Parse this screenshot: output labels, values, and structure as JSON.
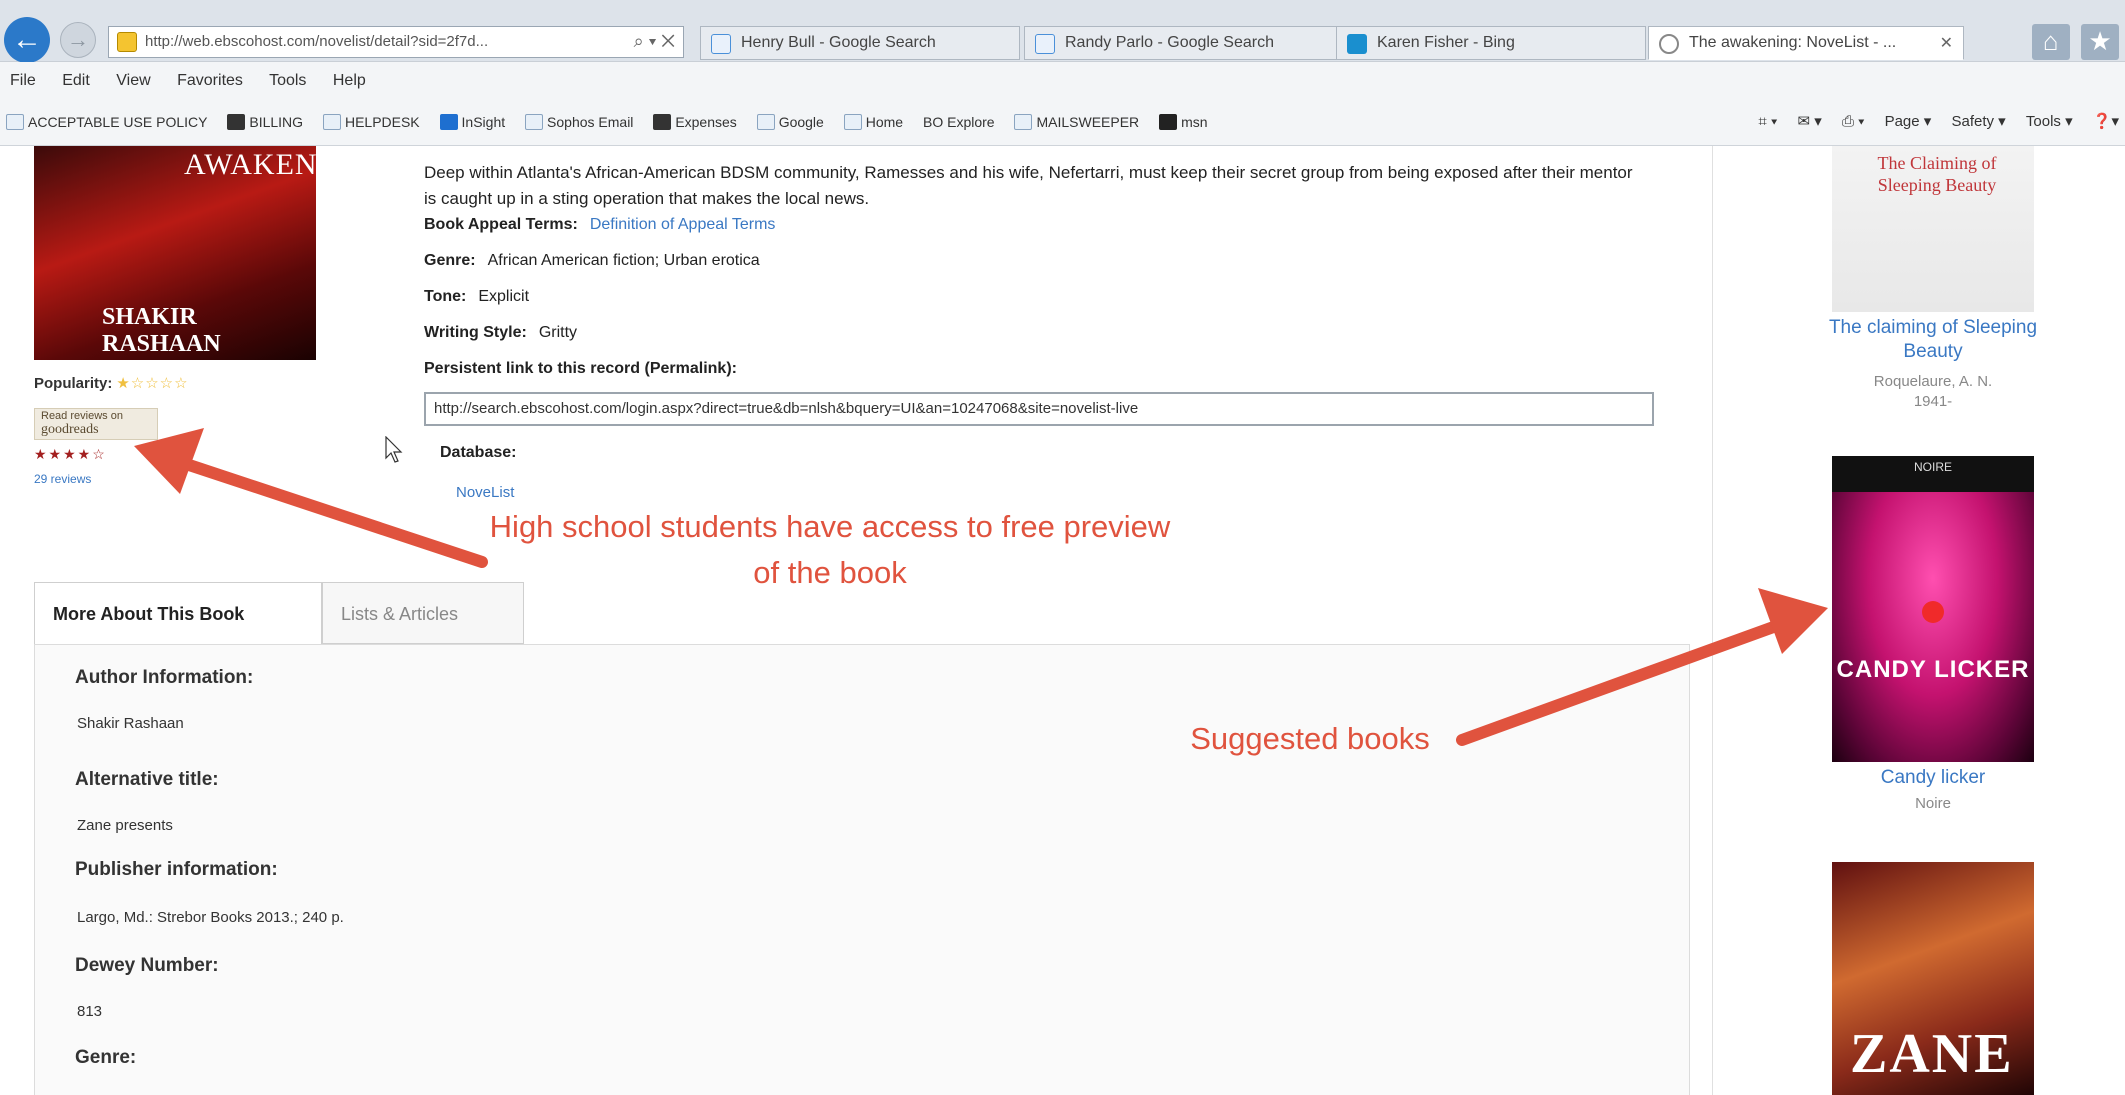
{
  "browser": {
    "address": "http://web.ebscohost.com/novelist/detail?sid=2f7d...",
    "tabs": [
      {
        "label": "Henry Bull - Google Search",
        "color": "#4a90d9"
      },
      {
        "label": "Randy Parlo - Google Search",
        "color": "#4a90d9"
      },
      {
        "label": "Karen Fisher - Bing",
        "color": "#1a8fcf"
      },
      {
        "label": "The awakening: NoveList - ...",
        "color": "#ffffff"
      }
    ],
    "window_controls": [
      "⌂",
      "★"
    ]
  },
  "menubar": [
    "File",
    "Edit",
    "View",
    "Favorites",
    "Tools",
    "Help"
  ],
  "favorites": [
    "ACCEPTABLE USE POLICY",
    "BILLING",
    "HELPDESK",
    "InSight",
    "Sophos Email",
    "Expenses",
    "Google",
    "Home",
    "BO Explore",
    "MAILSWEEPER",
    "msn"
  ],
  "commandbar": [
    "Page ▾",
    "Safety ▾",
    "Tools ▾",
    "❓▾"
  ],
  "book": {
    "cover_title": "AWAKENING",
    "cover_author": "SHAKIR RASHAAN",
    "popularity_label": "Popularity:",
    "popularity_stars": "★☆☆☆☆",
    "goodreads_small": "Read reviews on",
    "goodreads_logo": "goodreads",
    "goodreads_rating": "★★★★☆",
    "goodreads_reviews": "29 reviews",
    "summary": "Deep within Atlanta's African-American BDSM community, Ramesses and his wife, Nefertarri, must keep their secret group from being exposed after their mentor is caught up in a sting operation that makes the local news.",
    "appeal_label": "Book Appeal Terms:",
    "appeal_link": "Definition of Appeal Terms",
    "genre_label": "Genre:",
    "genre_value": "African American fiction; Urban erotica",
    "tone_label": "Tone:",
    "tone_value": "Explicit",
    "style_label": "Writing Style:",
    "style_value": "Gritty",
    "permalink_label": "Persistent link to this record (Permalink):",
    "permalink_value": "http://search.ebscohost.com/login.aspx?direct=true&db=nlsh&bquery=UI&an=10247068&site=novelist-live",
    "database_label": "Database:",
    "database_value": "NoveList"
  },
  "tabs": {
    "more": "More About This Book",
    "lists": "Lists & Articles"
  },
  "about": {
    "author_h": "Author Information:",
    "author_v": "Shakir Rashaan",
    "alt_title_h": "Alternative title:",
    "alt_title_v": "Zane presents",
    "publisher_h": "Publisher information:",
    "publisher_v": "Largo, Md.: Strebor Books 2013.; 240 p.",
    "dewey_h": "Dewey Number:",
    "dewey_v": "813",
    "genre_h": "Genre:"
  },
  "suggestions": [
    {
      "cover_text": "The Claiming of Sleeping Beauty",
      "title": "The claiming of Sleeping Beauty",
      "author": "Roquelaure, A. N.",
      "year": "1941-"
    },
    {
      "cover_top": "NOIRE",
      "cover_title": "CANDY LICKER",
      "title": "Candy licker",
      "author": "Noire"
    },
    {
      "cover_title": "ZANE"
    }
  ],
  "annotations": {
    "preview": "High school students have access to free preview of the book",
    "preview_line1": "High school students have access to free preview",
    "preview_line2": "of the book",
    "suggested": "Suggested books"
  }
}
